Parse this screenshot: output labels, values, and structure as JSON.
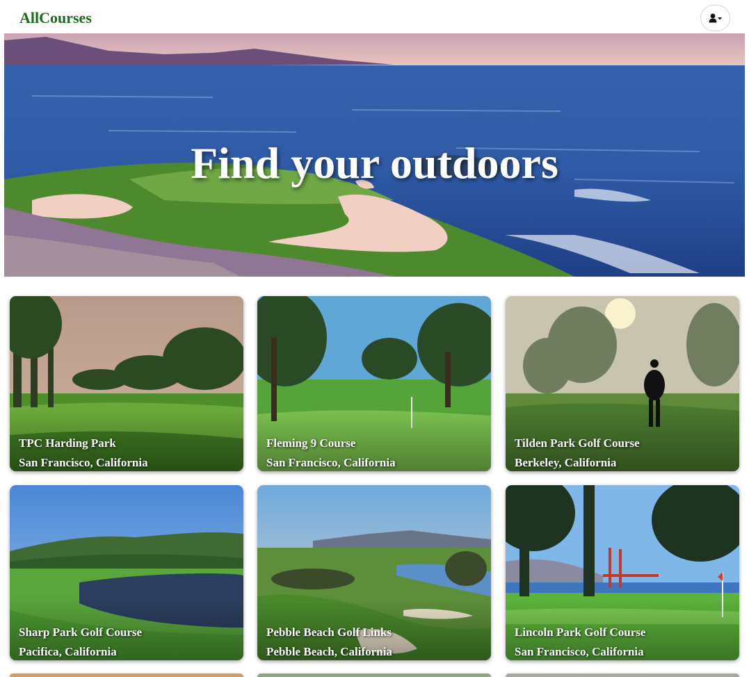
{
  "app": {
    "brand": "AllCourses",
    "user_menu_icon": "user-dropdown-icon"
  },
  "hero": {
    "title": "Find your outdoors"
  },
  "colors": {
    "brand": "#1a6b1a",
    "ocean": "#2b57a8",
    "grass": "#4e9a2e"
  },
  "courses": [
    {
      "name": "TPC Harding Park",
      "location": "San Francisco, California"
    },
    {
      "name": "Fleming 9 Course",
      "location": "San Francisco, California"
    },
    {
      "name": "Tilden Park Golf Course",
      "location": "Berkeley, California"
    },
    {
      "name": "Sharp Park Golf Course",
      "location": "Pacifica, California"
    },
    {
      "name": "Pebble Beach Golf Links",
      "location": "Pebble Beach, California"
    },
    {
      "name": "Lincoln Park Golf Course",
      "location": "San Francisco, California"
    }
  ]
}
